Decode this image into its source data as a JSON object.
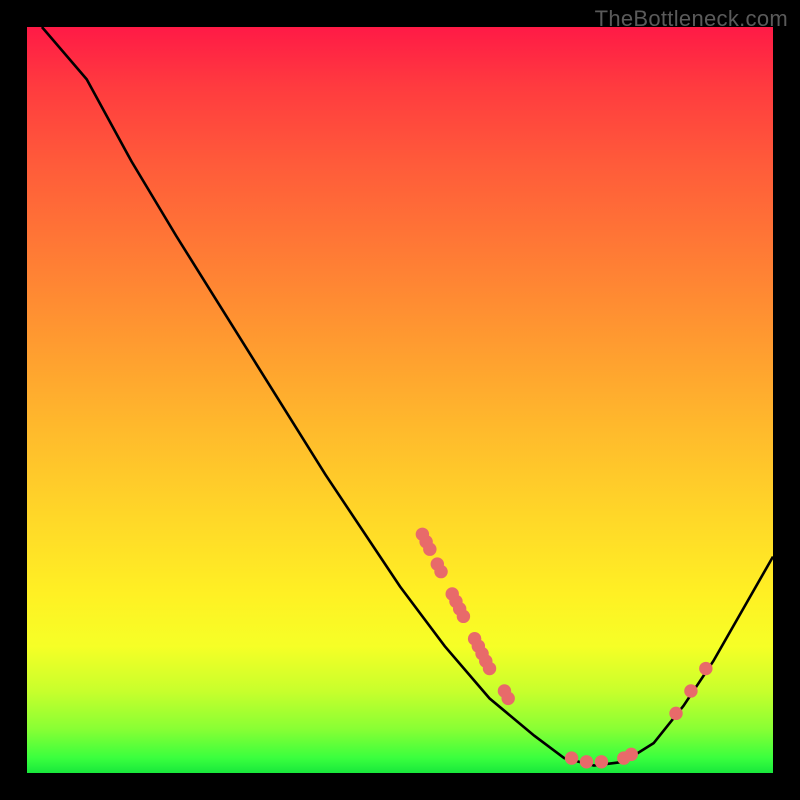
{
  "watermark": "TheBottleneck.com",
  "chart_data": {
    "type": "line",
    "title": "",
    "xlabel": "",
    "ylabel": "",
    "xlim": [
      0,
      100
    ],
    "ylim": [
      0,
      100
    ],
    "curve": {
      "name": "bottleneck-curve",
      "points": [
        {
          "x": 2,
          "y": 100
        },
        {
          "x": 8,
          "y": 93
        },
        {
          "x": 14,
          "y": 82
        },
        {
          "x": 20,
          "y": 72
        },
        {
          "x": 30,
          "y": 56
        },
        {
          "x": 40,
          "y": 40
        },
        {
          "x": 50,
          "y": 25
        },
        {
          "x": 56,
          "y": 17
        },
        {
          "x": 62,
          "y": 10
        },
        {
          "x": 68,
          "y": 5
        },
        {
          "x": 72,
          "y": 2
        },
        {
          "x": 76,
          "y": 1
        },
        {
          "x": 80,
          "y": 1.5
        },
        {
          "x": 84,
          "y": 4
        },
        {
          "x": 88,
          "y": 9
        },
        {
          "x": 92,
          "y": 15
        },
        {
          "x": 96,
          "y": 22
        },
        {
          "x": 100,
          "y": 29
        }
      ]
    },
    "markers": {
      "name": "data-points",
      "color": "#e86a6a",
      "points": [
        {
          "x": 53,
          "y": 32
        },
        {
          "x": 53.5,
          "y": 31
        },
        {
          "x": 54,
          "y": 30
        },
        {
          "x": 55,
          "y": 28
        },
        {
          "x": 55.5,
          "y": 27
        },
        {
          "x": 57,
          "y": 24
        },
        {
          "x": 57.5,
          "y": 23
        },
        {
          "x": 58,
          "y": 22
        },
        {
          "x": 58.5,
          "y": 21
        },
        {
          "x": 60,
          "y": 18
        },
        {
          "x": 60.5,
          "y": 17
        },
        {
          "x": 61,
          "y": 16
        },
        {
          "x": 61.5,
          "y": 15
        },
        {
          "x": 62,
          "y": 14
        },
        {
          "x": 64,
          "y": 11
        },
        {
          "x": 64.5,
          "y": 10
        },
        {
          "x": 73,
          "y": 2
        },
        {
          "x": 75,
          "y": 1.5
        },
        {
          "x": 77,
          "y": 1.5
        },
        {
          "x": 80,
          "y": 2
        },
        {
          "x": 81,
          "y": 2.5
        },
        {
          "x": 87,
          "y": 8
        },
        {
          "x": 89,
          "y": 11
        },
        {
          "x": 91,
          "y": 14
        }
      ]
    }
  }
}
